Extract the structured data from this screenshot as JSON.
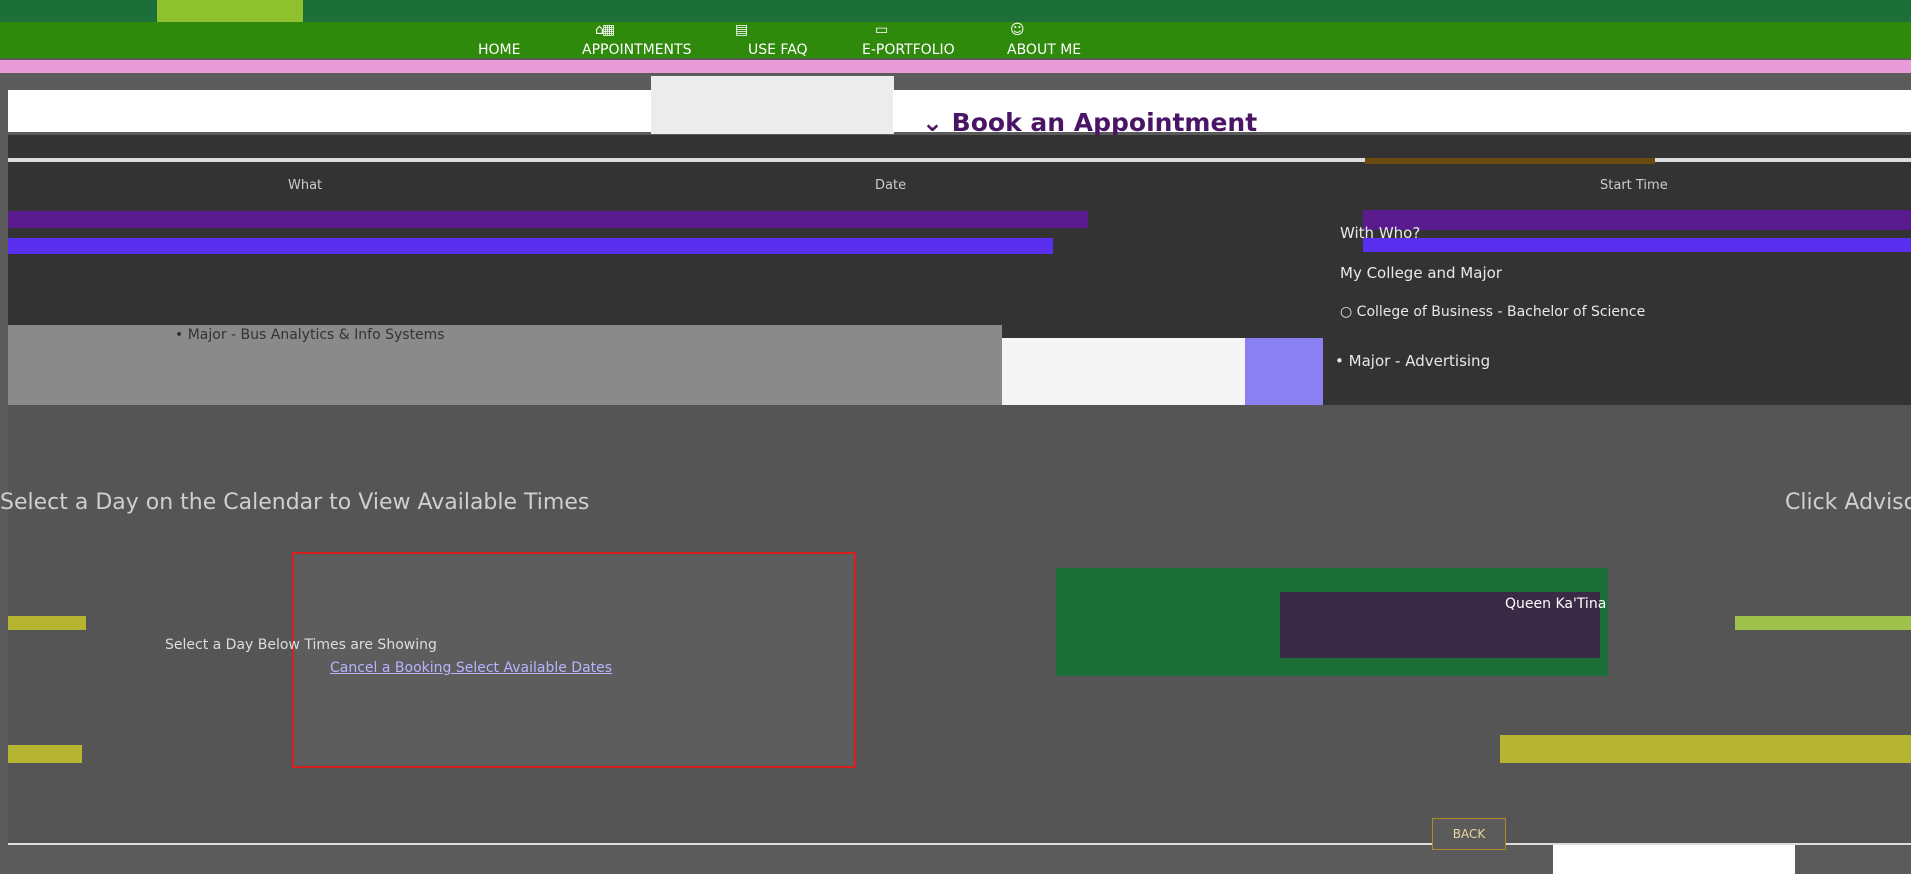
{
  "nav": {
    "items": [
      {
        "label": "HOME",
        "icon": "home-icon"
      },
      {
        "label": "APPOINTMENTS",
        "icon": "calendar-icon"
      },
      {
        "label": "USE FAQ",
        "icon": "document-icon"
      },
      {
        "label": "E-PORTFOLIO",
        "icon": "portfolio-icon"
      },
      {
        "label": "ABOUT ME",
        "icon": "user-icon"
      }
    ],
    "active": "E-PORTFOLIO"
  },
  "booking": {
    "heading": "Book an Appointment",
    "table_headers": [
      "What",
      "Date",
      "Start Time"
    ],
    "with_who_label": "With Who?",
    "college_major_label": "My College and Major",
    "college_line": "College of Business - Bachelor of Science",
    "major_primary": "Major - Bus Analytics & Info Systems",
    "major_secondary": "Major - Advertising"
  },
  "calendar": {
    "title": "Select a Day on the Calendar to View Available Times",
    "click_advisor": "Click Advisor",
    "link_text": "Cancel a Booking Select Available Dates",
    "note_text": "Select a Day Below Times are Showing"
  },
  "advisor_card": {
    "name": "Queen Ka'Tina"
  },
  "buttons": {
    "back": "BACK"
  },
  "colors": {
    "nav_green": "#2f8a0c",
    "accent_pink": "#e99ad9",
    "heading_purple": "#4a1565",
    "calendar_border": "#d42020"
  }
}
